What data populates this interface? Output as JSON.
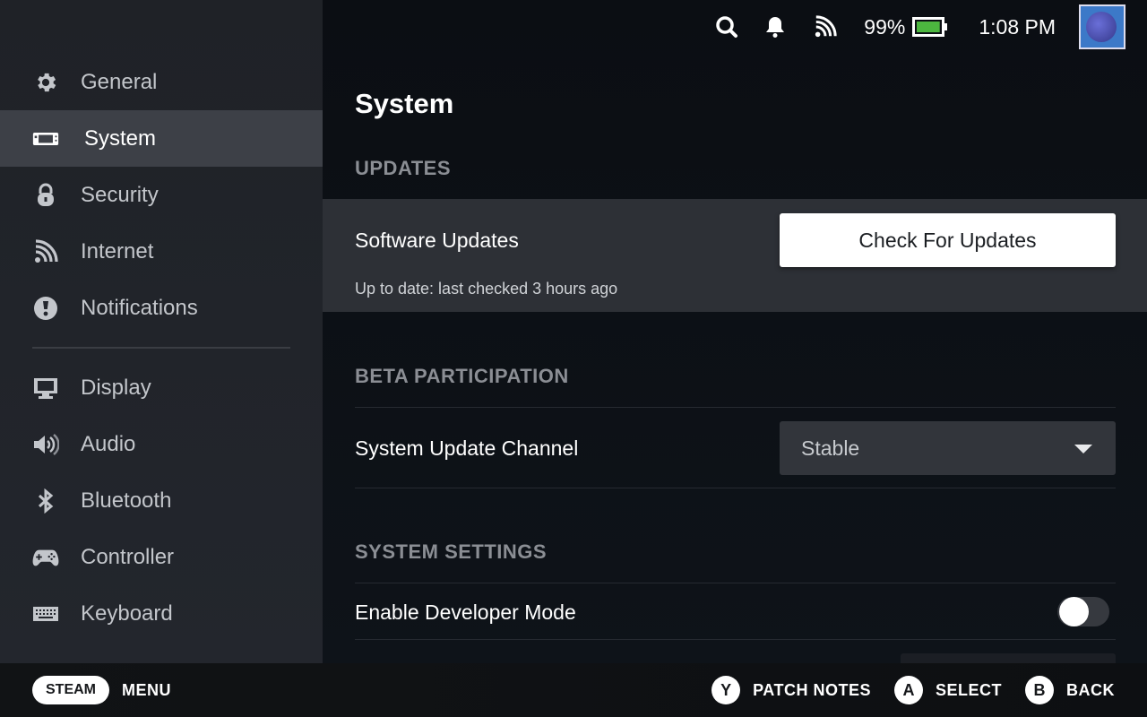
{
  "status_bar": {
    "icons": [
      "search-icon",
      "bell-icon",
      "wifi-icon"
    ],
    "battery_percent": "99%",
    "battery_level": 0.99,
    "battery_color": "#4cb63f",
    "time": "1:08 PM"
  },
  "sidebar": {
    "items": [
      {
        "label": "General",
        "icon": "gear-icon",
        "active": false
      },
      {
        "label": "System",
        "icon": "handheld-device-icon",
        "active": true
      },
      {
        "label": "Security",
        "icon": "lock-icon",
        "active": false
      },
      {
        "label": "Internet",
        "icon": "wifi-icon",
        "active": false
      },
      {
        "label": "Notifications",
        "icon": "alert-icon",
        "active": false
      },
      {
        "label": "Display",
        "icon": "monitor-icon",
        "active": false
      },
      {
        "label": "Audio",
        "icon": "speaker-icon",
        "active": false
      },
      {
        "label": "Bluetooth",
        "icon": "bluetooth-icon",
        "active": false
      },
      {
        "label": "Controller",
        "icon": "gamepad-icon",
        "active": false
      },
      {
        "label": "Keyboard",
        "icon": "keyboard-icon",
        "active": false
      }
    ]
  },
  "main": {
    "title": "System",
    "updates": {
      "section_title": "UPDATES",
      "software_updates_label": "Software Updates",
      "check_button": "Check For Updates",
      "status_text": "Up to date: last checked 3 hours ago"
    },
    "beta": {
      "section_title": "BETA PARTICIPATION",
      "channel_label": "System Update Channel",
      "channel_value": "Stable"
    },
    "system_settings": {
      "section_title": "SYSTEM SETTINGS",
      "developer_mode_label": "Enable Developer Mode",
      "developer_mode_enabled": false
    }
  },
  "footer": {
    "steam_label": "STEAM",
    "menu_label": "MENU",
    "actions": [
      {
        "button": "Y",
        "label": "PATCH NOTES"
      },
      {
        "button": "A",
        "label": "SELECT"
      },
      {
        "button": "B",
        "label": "BACK"
      }
    ]
  }
}
